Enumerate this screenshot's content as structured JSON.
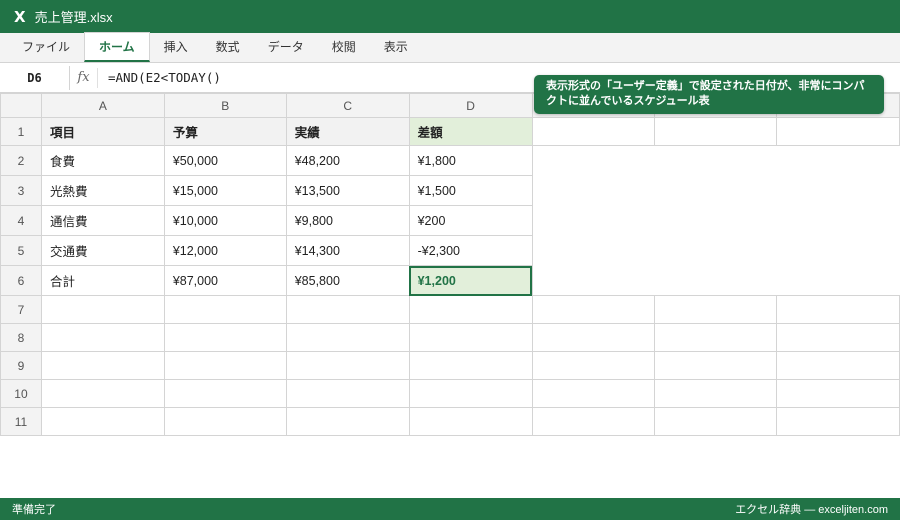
{
  "window": {
    "logo": "X",
    "filename": "売上管理.xlsx"
  },
  "ribbon": {
    "tabs": [
      "ファイル",
      "ホーム",
      "挿入",
      "数式",
      "データ",
      "校閲",
      "表示"
    ],
    "active": "ホーム"
  },
  "formula_bar": {
    "cell": "D6",
    "fx": "fx",
    "formula": "=AND(E2<TODAY()"
  },
  "callout": {
    "text": "表示形式の「ユーザー定義」で設定された日付が、非常にコンパクトに並んでいるスケジュール表"
  },
  "sheet": {
    "columns": [
      "A",
      "B",
      "C",
      "D"
    ],
    "row_numbers": [
      "1",
      "2",
      "3",
      "4",
      "5",
      "6",
      "7",
      "8",
      "9",
      "10",
      "11"
    ],
    "headers": [
      "項目",
      "予算",
      "実績",
      "差額"
    ],
    "rows": [
      [
        "食費",
        "¥50,000",
        "¥48,200",
        "¥1,800"
      ],
      [
        "光熱費",
        "¥15,000",
        "¥13,500",
        "¥1,500"
      ],
      [
        "通信費",
        "¥10,000",
        "¥9,800",
        "¥200"
      ],
      [
        "交通費",
        "¥12,000",
        "¥14,300",
        "-¥2,300"
      ],
      [
        "合計",
        "¥87,000",
        "¥85,800",
        "¥1,200"
      ]
    ],
    "selected_cell": "D6"
  },
  "status": {
    "left": "準備完了",
    "right": "エクセル辞典 — exceljiten.com"
  },
  "colors": {
    "brand": "#217346",
    "highlight": "#e2efda"
  }
}
